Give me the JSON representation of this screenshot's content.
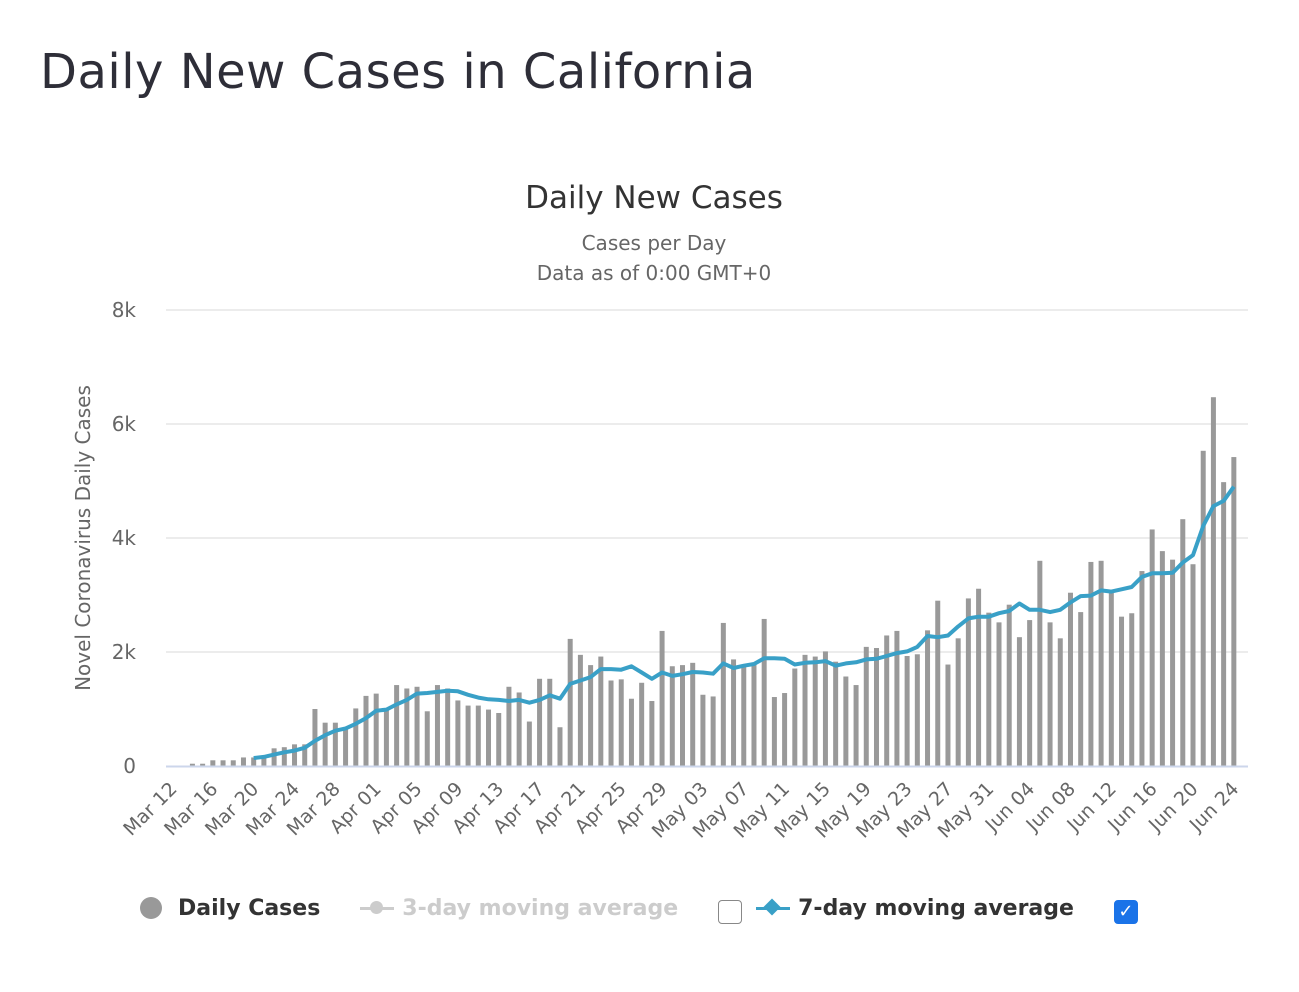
{
  "page": {
    "title": "Daily New Cases in California"
  },
  "legend": {
    "daily_cases": "Daily Cases",
    "ma3": "3-day moving average",
    "ma3_checked": false,
    "ma7": "7-day moving average",
    "ma7_checked": true,
    "checkmark": "✓"
  },
  "colors": {
    "bars": "#999999",
    "ma7": "#39a0c7",
    "ma3_faded": "#cccccc",
    "grid": "#e6e6e6",
    "axis": "#ccd6eb",
    "checkbox": "#1a73e8"
  },
  "chart_data": {
    "type": "bar",
    "title": "Daily New Cases",
    "subtitle": [
      "Cases per Day",
      "Data as of 0:00 GMT+0"
    ],
    "xlabel": "",
    "ylabel": "Novel Coronavirus Daily Cases",
    "ylim": [
      0,
      8000
    ],
    "yticks": [
      0,
      2000,
      4000,
      6000,
      8000
    ],
    "ytick_labels": [
      "0",
      "2k",
      "4k",
      "6k",
      "8k"
    ],
    "xtick_labels": [
      "Mar 12",
      "Mar 16",
      "Mar 20",
      "Mar 24",
      "Mar 28",
      "Apr 01",
      "Apr 05",
      "Apr 09",
      "Apr 13",
      "Apr 17",
      "Apr 21",
      "Apr 25",
      "Apr 29",
      "May 03",
      "May 07",
      "May 11",
      "May 15",
      "May 19",
      "May 23",
      "May 27",
      "May 31",
      "Jun 04",
      "Jun 08",
      "Jun 12",
      "Jun 16",
      "Jun 20",
      "Jun 24"
    ],
    "xtick_every": 4,
    "legend_position": "bottom",
    "grid": true,
    "start_date": "Mar 12",
    "series": [
      {
        "name": "Daily Cases",
        "type": "bar",
        "values": [
          0,
          0,
          40,
          40,
          100,
          100,
          100,
          150,
          150,
          150,
          310,
          330,
          380,
          380,
          1000,
          760,
          760,
          640,
          1010,
          1230,
          1270,
          980,
          1420,
          1360,
          1390,
          960,
          1420,
          1360,
          1150,
          1060,
          1060,
          990,
          930,
          1390,
          1290,
          780,
          1530,
          1530,
          680,
          2230,
          1950,
          1770,
          1920,
          1500,
          1520,
          1180,
          1460,
          1140,
          2370,
          1750,
          1770,
          1810,
          1250,
          1220,
          2510,
          1870,
          1750,
          1780,
          2580,
          1210,
          1280,
          1710,
          1950,
          1920,
          2010,
          1830,
          1570,
          1420,
          2090,
          2070,
          2290,
          2370,
          1930,
          1960,
          2380,
          2900,
          1780,
          2240,
          2940,
          3110,
          2690,
          2520,
          2830,
          2260,
          2560,
          3600,
          2520,
          2240,
          3040,
          2700,
          3580,
          3600,
          3070,
          2620,
          2680,
          3420,
          4150,
          3770,
          3620,
          4330,
          3540,
          5530,
          6470,
          4980,
          5420
        ],
        "note": "one bar per day starting Mar 12; first three approximate"
      },
      {
        "name": "7-day moving average",
        "type": "line",
        "start_index": 8,
        "values": [
          140,
          160,
          200,
          240,
          270,
          320,
          440,
          540,
          620,
          660,
          740,
          840,
          970,
          990,
          1080,
          1160,
          1270,
          1280,
          1300,
          1320,
          1310,
          1250,
          1200,
          1170,
          1160,
          1140,
          1160,
          1110,
          1160,
          1240,
          1180,
          1440,
          1500,
          1560,
          1700,
          1700,
          1690,
          1750,
          1640,
          1530,
          1640,
          1580,
          1610,
          1650,
          1640,
          1620,
          1800,
          1720,
          1760,
          1790,
          1890,
          1890,
          1880,
          1780,
          1810,
          1820,
          1840,
          1760,
          1800,
          1820,
          1870,
          1880,
          1930,
          1980,
          2010,
          2090,
          2280,
          2260,
          2290,
          2450,
          2590,
          2620,
          2620,
          2680,
          2720,
          2850,
          2740,
          2740,
          2700,
          2740,
          2870,
          2980,
          2990,
          3080,
          3060,
          3100,
          3140,
          3320,
          3380,
          3380,
          3390,
          3570,
          3700,
          4210,
          4560,
          4650,
          4900
        ]
      }
    ]
  }
}
